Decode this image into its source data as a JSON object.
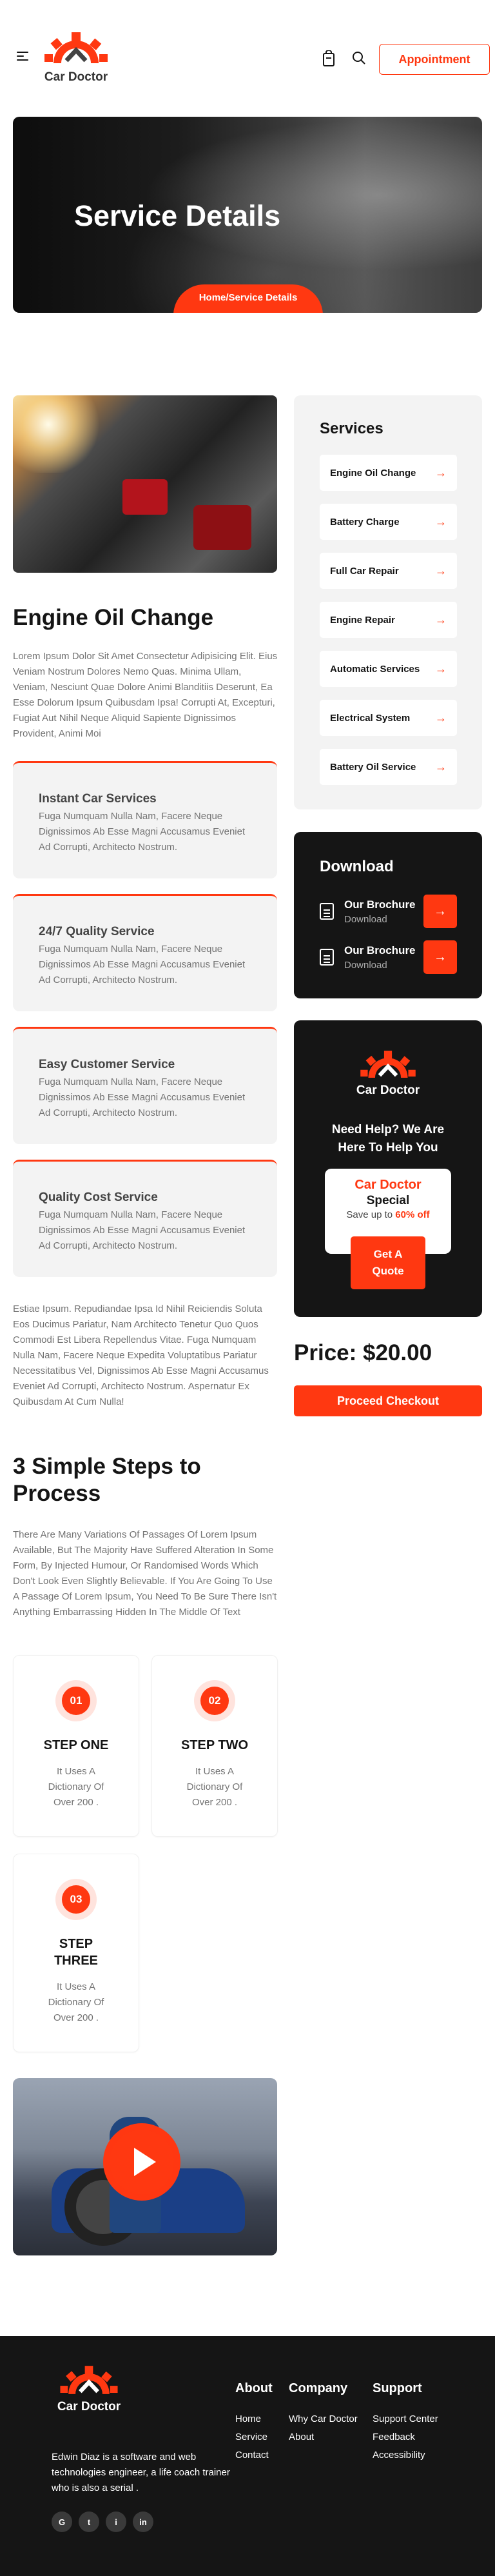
{
  "header": {
    "brand": "Car Doctor",
    "appointment_label": "Appointment"
  },
  "hero": {
    "title": "Service Details",
    "breadcrumb": "Home/Service Details"
  },
  "main": {
    "title": "Engine Oil Change",
    "intro": "Lorem Ipsum Dolor Sit Amet Consectetur Adipisicing Elit. Eius Veniam Nostrum Dolores Nemo Quas. Minima Ullam, Veniam, Nesciunt Quae Dolore Animi Blanditiis Deserunt, Ea Esse Dolorum Ipsum Quibusdam Ipsa! Corrupti At, Excepturi, Fugiat Aut Nihil Neque Aliquid Sapiente Dignissimos Provident, Animi Moi",
    "features": [
      {
        "title": "Instant Car Services",
        "text": "Fuga Numquam Nulla Nam, Facere Neque Dignissimos Ab Esse Magni Accusamus Eveniet Ad Corrupti, Architecto Nostrum."
      },
      {
        "title": "24/7 Quality Service",
        "text": "Fuga Numquam Nulla Nam, Facere Neque Dignissimos Ab Esse Magni Accusamus Eveniet Ad Corrupti, Architecto Nostrum."
      },
      {
        "title": "Easy Customer Service",
        "text": "Fuga Numquam Nulla Nam, Facere Neque Dignissimos Ab Esse Magni Accusamus Eveniet Ad Corrupti, Architecto Nostrum."
      },
      {
        "title": "Quality Cost Service",
        "text": "Fuga Numquam Nulla Nam, Facere Neque Dignissimos Ab Esse Magni Accusamus Eveniet Ad Corrupti, Architecto Nostrum."
      }
    ],
    "outro": "Estiae Ipsum. Repudiandae Ipsa Id Nihil Reiciendis Soluta Eos Ducimus Pariatur, Nam Architecto Tenetur Quo Quos Commodi Est Libera Repellendus Vitae. Fuga Numquam Nulla Nam, Facere Neque Expedita Voluptatibus Pariatur Necessitatibus Vel, Dignissimos Ab Esse Magni Accusamus Eveniet Ad Corrupti, Architecto Nostrum. Aspernatur Ex Quibusdam At Cum Nulla!",
    "steps_title": "3 Simple Steps to Process",
    "steps_text": "There Are Many Variations Of Passages Of Lorem Ipsum Available, But The Majority Have Suffered Alteration In Some Form, By Injected Humour, Or Randomised Words Which Don't Look Even Slightly Believable. If You Are Going To Use A Passage Of Lorem Ipsum, You Need To Be Sure There Isn't Anything Embarrassing Hidden In The Middle Of Text",
    "steps": [
      {
        "num": "01",
        "title": "STEP ONE",
        "text": "It Uses A Dictionary Of Over 200 ."
      },
      {
        "num": "02",
        "title": "STEP TWO",
        "text": "It Uses A Dictionary Of Over 200 ."
      },
      {
        "num": "03",
        "title": "STEP THREE",
        "text": "It Uses A Dictionary Of Over 200 ."
      }
    ]
  },
  "sidebar": {
    "services_title": "Services",
    "services": [
      {
        "label": "Engine Oil Change"
      },
      {
        "label": "Battery Charge"
      },
      {
        "label": "Full Car Repair"
      },
      {
        "label": "Engine Repair"
      },
      {
        "label": "Automatic Services"
      },
      {
        "label": "Electrical System"
      },
      {
        "label": "Battery Oil Service"
      }
    ],
    "download_title": "Download",
    "downloads": [
      {
        "name": "Our Brochure",
        "sub": "Download"
      },
      {
        "name": "Our Brochure",
        "sub": "Download"
      }
    ],
    "help": {
      "brand": "Car Doctor",
      "title": "Need Help? We Are Here To Help You",
      "card_brand": "Car Doctor",
      "card_special": "Special",
      "save_prefix": "Save up to",
      "save_value": "60% off",
      "quote_label": "Get A Quote"
    },
    "price": "Price: $20.00",
    "checkout_label": "Proceed Checkout"
  },
  "footer": {
    "brand": "Car Doctor",
    "about": "Edwin Diaz is a software and web technologies engineer, a life coach trainer who is also a serial .",
    "socials": [
      "G",
      "t",
      "i",
      "in"
    ],
    "columns": [
      {
        "title": "About",
        "links": [
          "Home",
          "Service",
          "Contact"
        ]
      },
      {
        "title": "Company",
        "links": [
          "Why Car Doctor",
          "About"
        ]
      },
      {
        "title": "Support",
        "links": [
          "Support Center",
          "Feedback",
          "Accessibility"
        ]
      }
    ]
  },
  "colors": {
    "accent": "#FF3811",
    "dark": "#151515",
    "muted": "#737373",
    "panel": "#F3F3F3"
  },
  "icons": [
    "menu-icon",
    "shopping-bag-icon",
    "search-icon",
    "arrow-right-icon",
    "file-icon",
    "play-icon",
    "google-icon",
    "twitter-icon",
    "instagram-icon",
    "linkedin-icon"
  ]
}
